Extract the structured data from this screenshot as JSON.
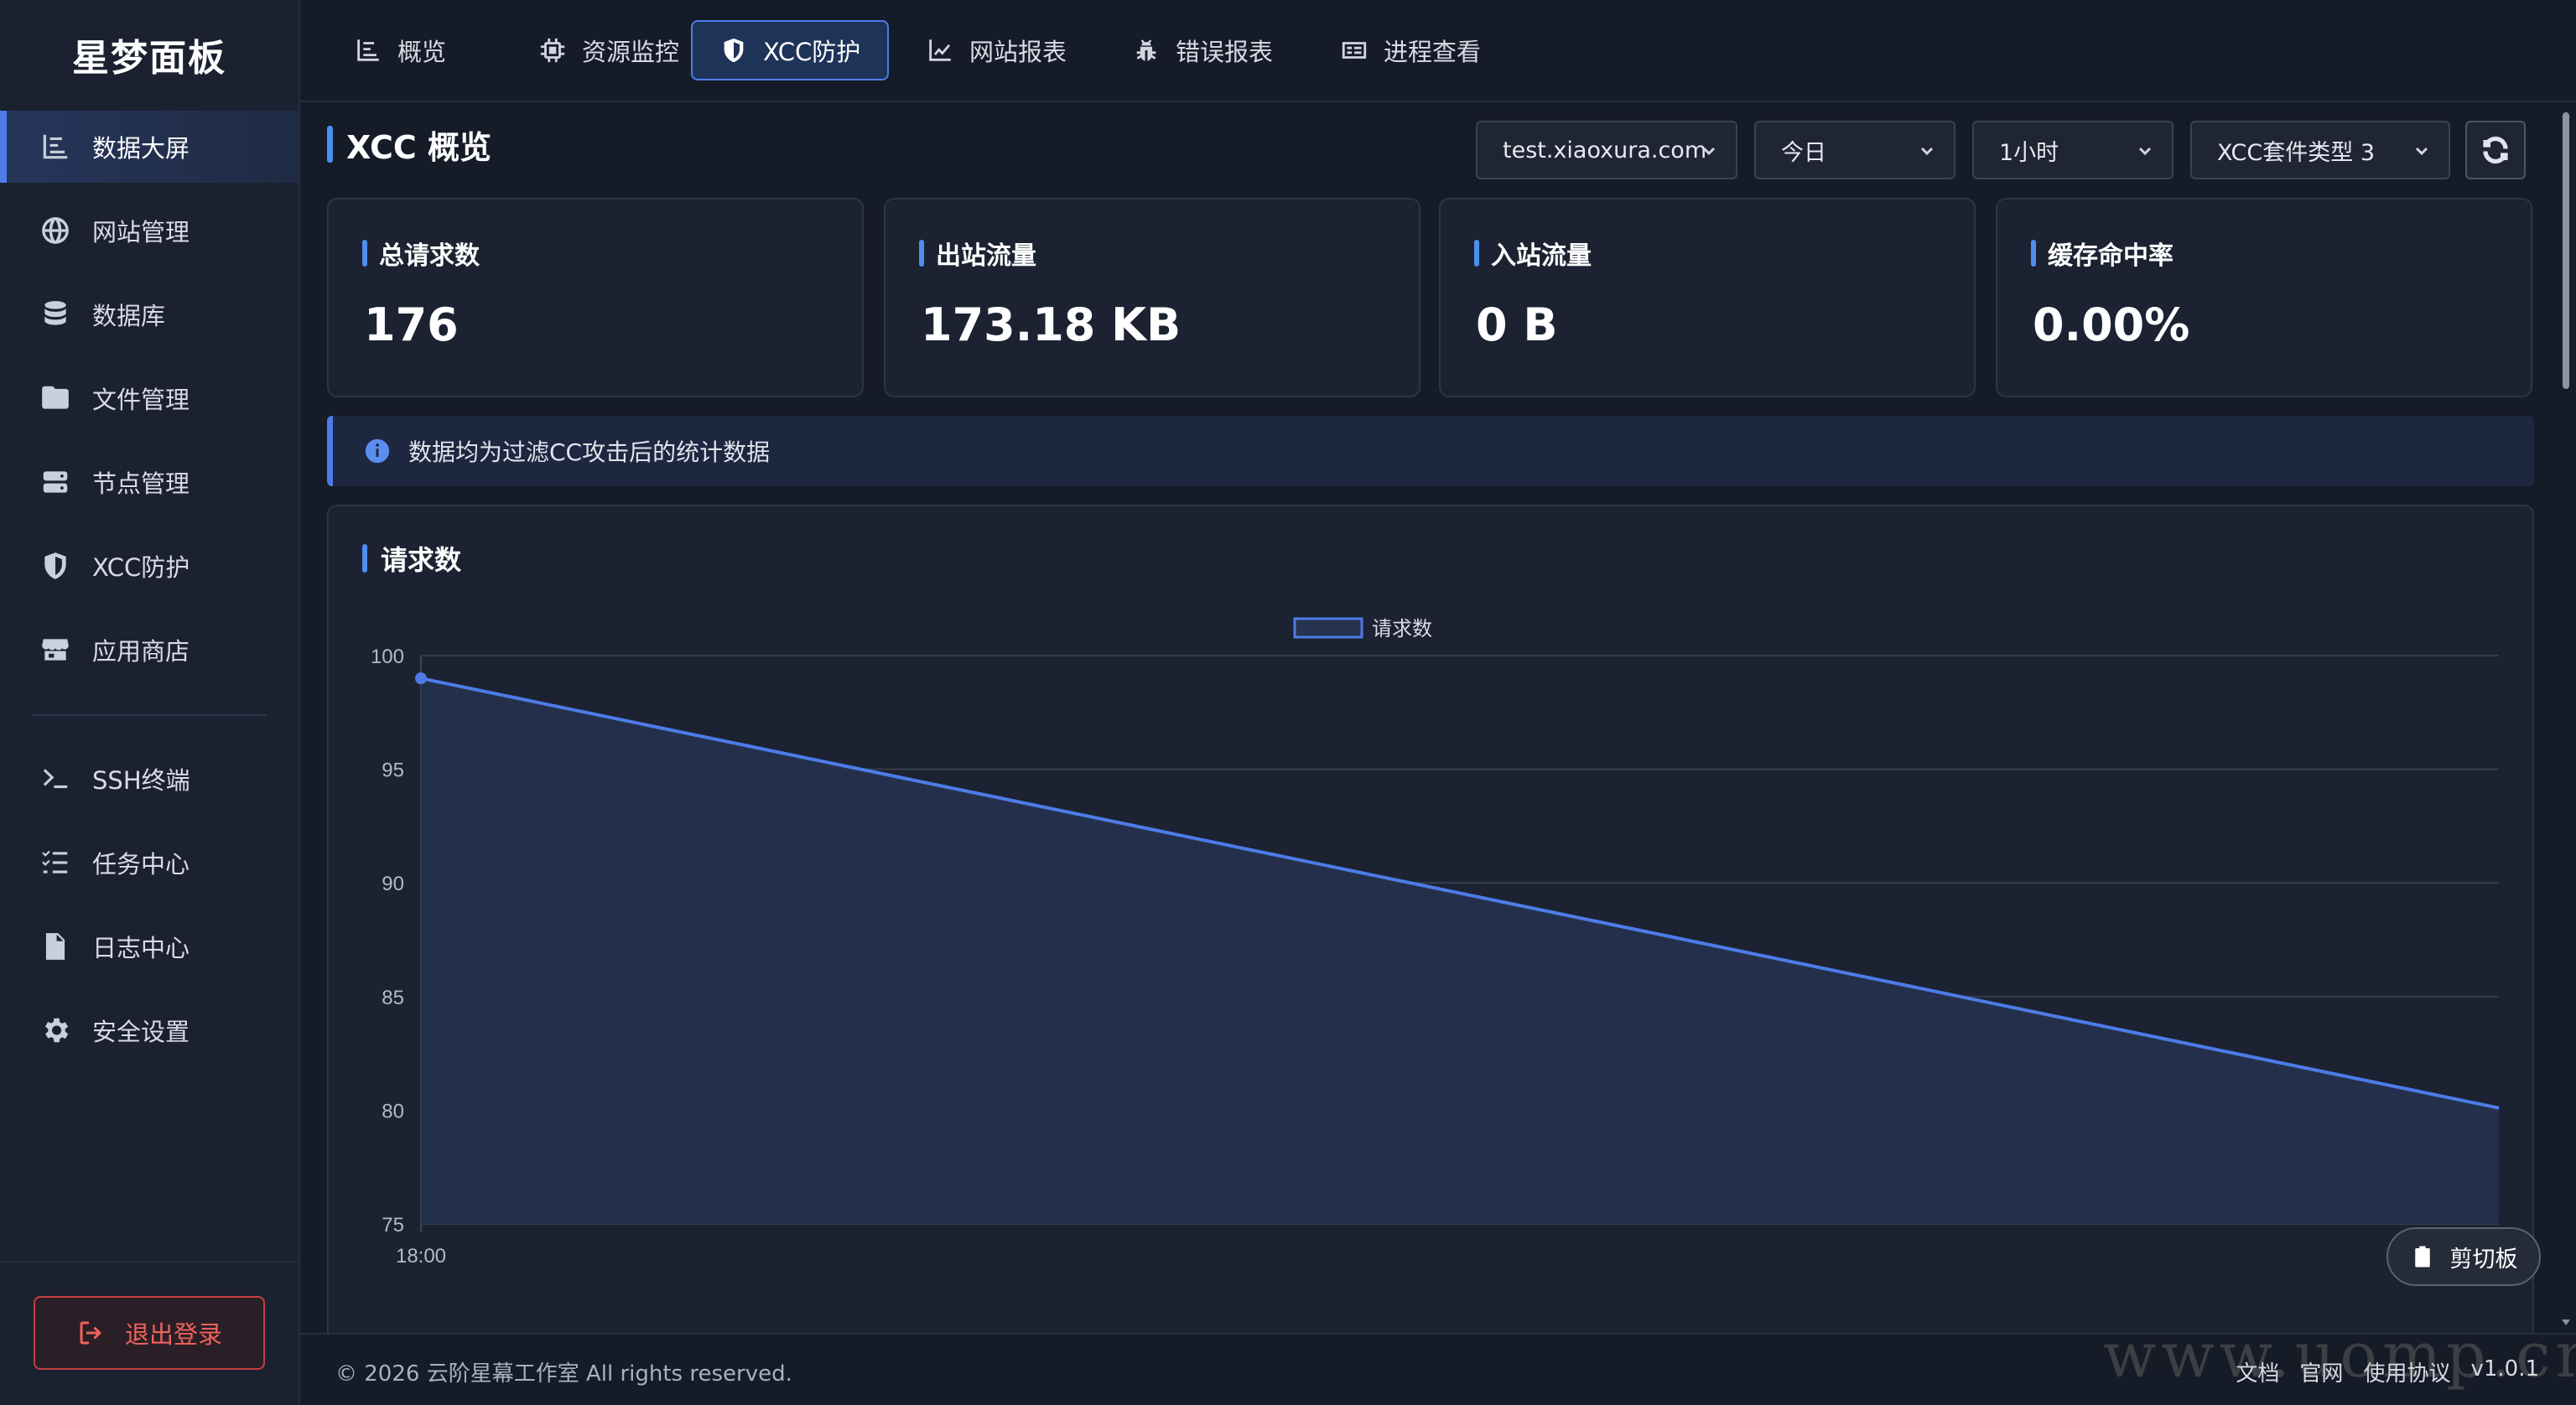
{
  "app": {
    "brand": "星梦面板"
  },
  "sidebar": {
    "items": [
      {
        "label": "数据大屏",
        "icon": "chart-icon",
        "active": true
      },
      {
        "label": "网站管理",
        "icon": "globe-icon"
      },
      {
        "label": "数据库",
        "icon": "database-icon"
      },
      {
        "label": "文件管理",
        "icon": "folder-icon"
      },
      {
        "label": "节点管理",
        "icon": "server-icon"
      },
      {
        "label": "XCC防护",
        "icon": "shield-icon"
      },
      {
        "label": "应用商店",
        "icon": "store-icon"
      },
      {
        "label": "SSH终端",
        "icon": "terminal-icon"
      },
      {
        "label": "任务中心",
        "icon": "list-icon"
      },
      {
        "label": "日志中心",
        "icon": "file-icon"
      },
      {
        "label": "安全设置",
        "icon": "gear-icon"
      }
    ],
    "logout": "退出登录"
  },
  "topnav": {
    "tabs": [
      {
        "label": "概览",
        "icon": "chart-icon"
      },
      {
        "label": "资源监控",
        "icon": "chip-icon"
      },
      {
        "label": "XCC防护",
        "icon": "shield-icon",
        "active": true
      },
      {
        "label": "网站报表",
        "icon": "line-chart-icon"
      },
      {
        "label": "错误报表",
        "icon": "bug-icon"
      },
      {
        "label": "进程查看",
        "icon": "id-card-icon"
      }
    ]
  },
  "overview": {
    "title": "XCC 概览",
    "filters": {
      "site": "test.xiaoxura.com",
      "date": "今日",
      "interval": "1小时",
      "package": "XCC套件类型 3"
    }
  },
  "stats": [
    {
      "label": "总请求数",
      "value": "176"
    },
    {
      "label": "出站流量",
      "value": "173.18 KB"
    },
    {
      "label": "入站流量",
      "value": "0 B"
    },
    {
      "label": "缓存命中率",
      "value": "0.00%"
    }
  ],
  "info": {
    "text": "数据均为过滤CC攻击后的统计数据"
  },
  "chart_title": "请求数",
  "chart_data": {
    "type": "area",
    "x": [
      "18:00",
      ""
    ],
    "series": [
      {
        "name": "请求数",
        "values": [
          99,
          80.1
        ]
      }
    ],
    "ylim": [
      75,
      100
    ],
    "yticks": [
      75,
      80,
      85,
      90,
      95,
      100
    ],
    "xticks": [
      "18:00"
    ],
    "legend": "top-center",
    "grid": true,
    "color": "#4d7ce8",
    "fill": "#26324f"
  },
  "clipboard": "剪切板",
  "footer": {
    "copyright": "© 2026 云阶星幕工作室 All rights reserved.",
    "links": [
      "文档",
      "官网",
      "使用协议",
      "v1.0.1"
    ],
    "watermark": "www.uomp.cn"
  }
}
